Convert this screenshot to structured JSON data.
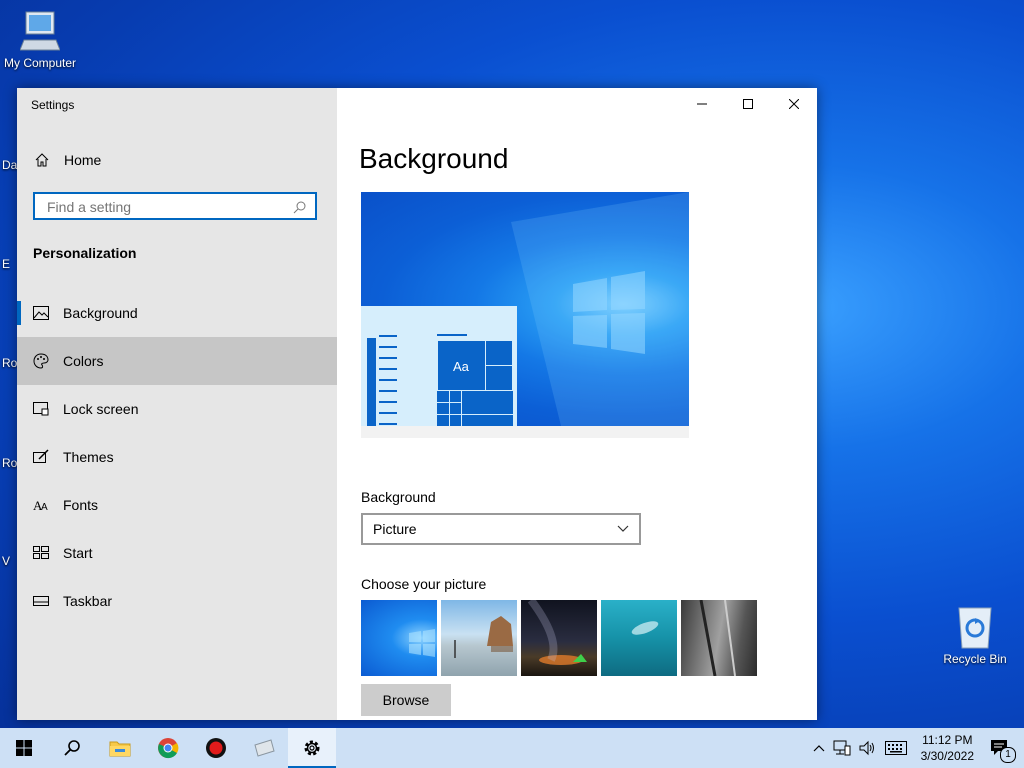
{
  "desktop": {
    "my_computer_label": "My Computer",
    "recycle_bin_label": "Recycle Bin",
    "edge_labels": [
      "Da",
      "E",
      "Ro",
      "Ro",
      "V"
    ]
  },
  "window": {
    "title": "Settings",
    "home_label": "Home",
    "search_placeholder": "Find a setting",
    "section_title": "Personalization",
    "nav": [
      {
        "label": "Background",
        "icon": "picture-icon"
      },
      {
        "label": "Colors",
        "icon": "palette-icon"
      },
      {
        "label": "Lock screen",
        "icon": "lock-screen-icon"
      },
      {
        "label": "Themes",
        "icon": "themes-icon"
      },
      {
        "label": "Fonts",
        "icon": "fonts-icon"
      },
      {
        "label": "Start",
        "icon": "start-icon"
      },
      {
        "label": "Taskbar",
        "icon": "taskbar-icon"
      }
    ],
    "active_nav": "Background",
    "hover_nav": "Colors"
  },
  "content": {
    "page_title": "Background",
    "preview_sample_text": "Aa",
    "background_label": "Background",
    "background_value": "Picture",
    "choose_label": "Choose your picture",
    "browse_label": "Browse"
  },
  "taskbar": {
    "time": "11:12 PM",
    "date": "3/30/2022",
    "notification_count": "1"
  },
  "colors": {
    "accent": "#0067c0",
    "sidebar_bg": "#e6e6e6",
    "hover_bg": "#c6c6c6",
    "taskbar_bg": "#cde0f5"
  }
}
